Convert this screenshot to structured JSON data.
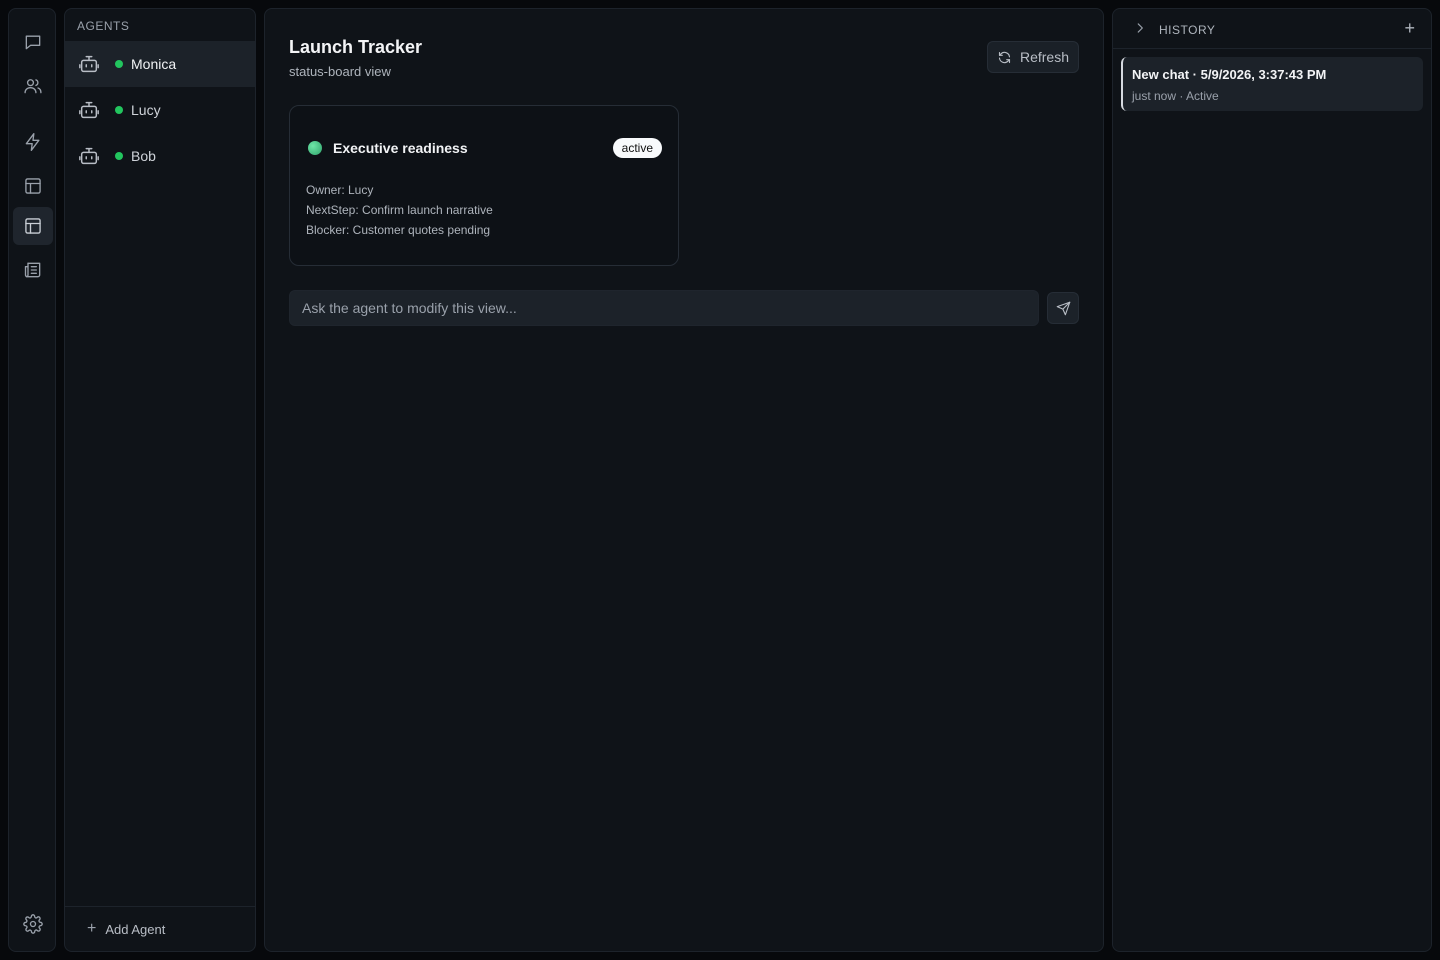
{
  "rail": {
    "items": [
      {
        "icon": "chat-icon"
      },
      {
        "icon": "users-icon"
      },
      {
        "icon": "lightning-icon"
      },
      {
        "icon": "layout-icon"
      },
      {
        "icon": "layout-icon",
        "active": true
      },
      {
        "icon": "newspaper-icon"
      }
    ],
    "settings_icon": "gear-icon"
  },
  "agents": {
    "title": "AGENTS",
    "items": [
      {
        "name": "Monica",
        "status_color": "#22c55e"
      },
      {
        "name": "Lucy",
        "status_color": "#22c55e"
      },
      {
        "name": "Bob",
        "status_color": "#22c55e"
      }
    ],
    "add_label": "Add Agent"
  },
  "main": {
    "title": "Launch Tracker",
    "subtitle": "status-board view",
    "refresh_label": "Refresh",
    "card": {
      "title": "Executive readiness",
      "badge": "active",
      "owner": "Owner: Lucy",
      "next_step": "NextStep: Confirm launch narrative",
      "blocker": "Blocker: Customer quotes pending"
    },
    "prompt_placeholder": "Ask the agent to modify this view..."
  },
  "history": {
    "title": "HISTORY",
    "items": [
      {
        "title": "New chat · 5/9/2026, 3:37:43 PM",
        "meta": "just now · Active"
      }
    ]
  }
}
